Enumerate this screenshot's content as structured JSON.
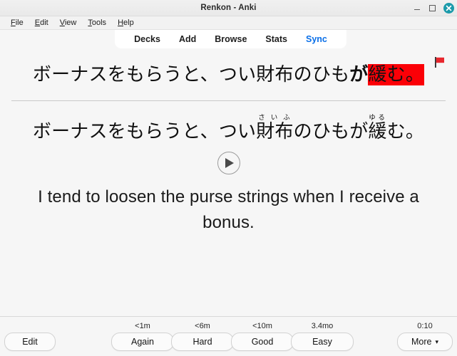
{
  "window": {
    "title": "Renkon - Anki",
    "controls": {
      "minimize": "minimize-button",
      "maximize": "maximize-button",
      "close": "close-button"
    },
    "close_color": "#1b9aaa"
  },
  "menubar": {
    "items": [
      {
        "mnemonic": "F",
        "rest": "ile"
      },
      {
        "mnemonic": "E",
        "rest": "dit"
      },
      {
        "mnemonic": "V",
        "rest": "iew"
      },
      {
        "mnemonic": "T",
        "rest": "ools"
      },
      {
        "mnemonic": "H",
        "rest": "elp"
      }
    ]
  },
  "nav": {
    "items": [
      {
        "label": "Decks",
        "accent": false
      },
      {
        "label": "Add",
        "accent": false
      },
      {
        "label": "Browse",
        "accent": false
      },
      {
        "label": "Stats",
        "accent": false
      },
      {
        "label": "Sync",
        "accent": true
      }
    ],
    "accent_color": "#0a6fe8"
  },
  "card": {
    "flag": {
      "icon": "red-flag-icon",
      "color": "#e8272e"
    },
    "question": {
      "prefix": "ボーナスをもらうと、つい財布のひも",
      "bold": "が",
      "highlighted": "緩む。",
      "highlight_color": "#fb0007"
    },
    "answer": {
      "segment1": "ボーナスをもらうと、つい",
      "ruby1_base": "財布",
      "ruby1_text": "さいふ",
      "segment2": "のひもが",
      "ruby2_base": "緩",
      "ruby2_text": "ゆる",
      "segment3": "む。"
    },
    "audio_button": "play-audio-button",
    "translation": "I tend to loosen the purse strings when I receive a bonus."
  },
  "bottom": {
    "edit": {
      "label": "Edit",
      "eta": ""
    },
    "answers": [
      {
        "label": "Again",
        "eta": "<1m"
      },
      {
        "label": "Hard",
        "eta": "<6m"
      },
      {
        "label": "Good",
        "eta": "<10m"
      },
      {
        "label": "Easy",
        "eta": "3.4mo"
      }
    ],
    "more": {
      "label": "More",
      "caret": "▾",
      "eta": "0:10"
    }
  }
}
